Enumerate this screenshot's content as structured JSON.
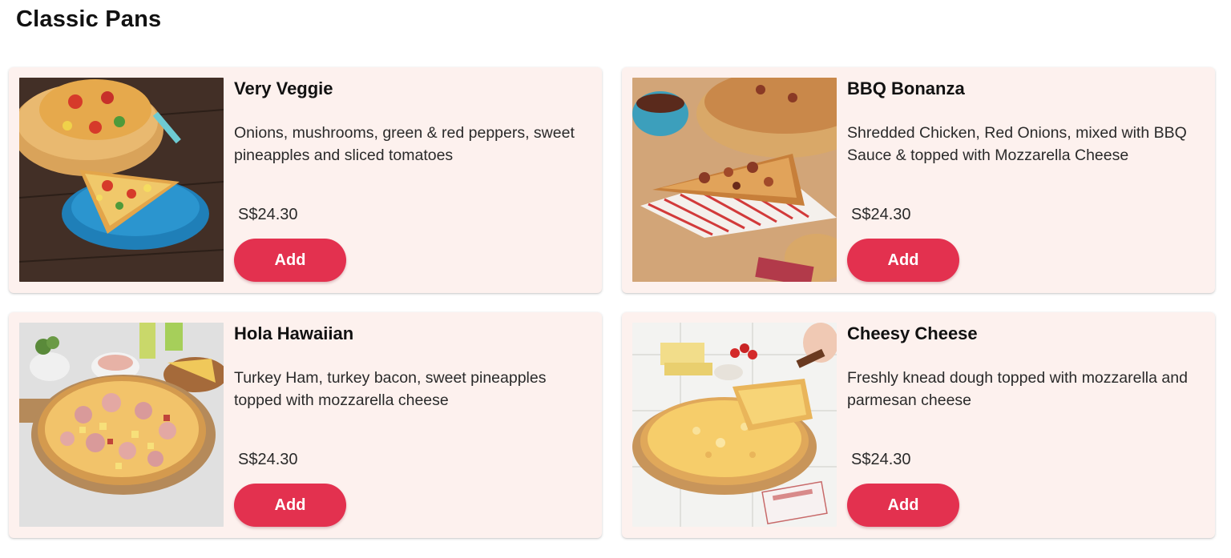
{
  "section": {
    "title": "Classic Pans"
  },
  "products": [
    {
      "name": "Very Veggie",
      "description": "Onions, mushrooms, green & red peppers, sweet pineapples and sliced tomatoes",
      "price": "S$24.30",
      "button_label": "Add",
      "image_icon": "very-veggie-pizza-image"
    },
    {
      "name": "BBQ Bonanza",
      "description": "Shredded Chicken, Red Onions, mixed with BBQ Sauce & topped with Mozzarella Cheese",
      "price": "S$24.30",
      "button_label": "Add",
      "image_icon": "bbq-bonanza-pizza-image"
    },
    {
      "name": "Hola Hawaiian",
      "description": "Turkey Ham, turkey bacon, sweet pineapples topped with mozzarella cheese",
      "price": "S$24.30",
      "button_label": "Add",
      "image_icon": "hola-hawaiian-pizza-image"
    },
    {
      "name": "Cheesy Cheese",
      "description": "Freshly knead dough topped with mozzarella and parmesan cheese",
      "price": "S$24.30",
      "button_label": "Add",
      "image_icon": "cheesy-cheese-pizza-image"
    }
  ],
  "colors": {
    "card_background": "#fdf1ee",
    "button_background": "#e3314f",
    "button_text": "#ffffff"
  }
}
